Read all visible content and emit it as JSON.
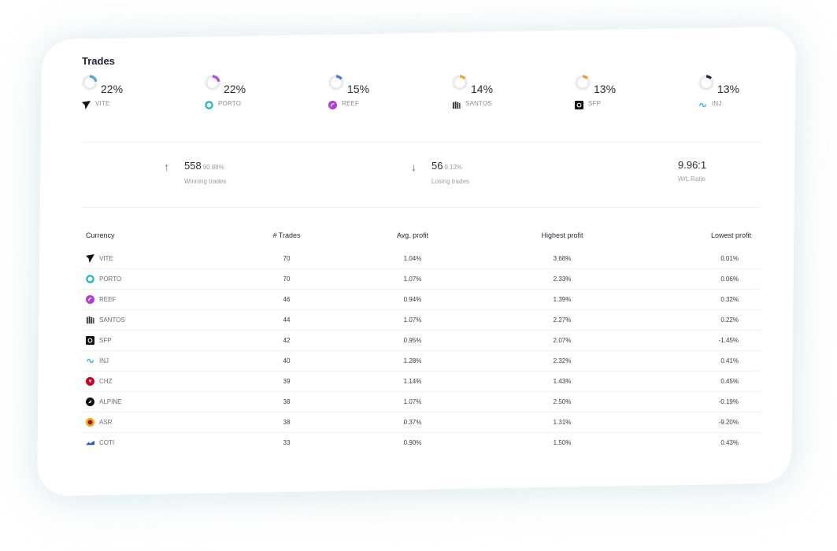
{
  "title": "Trades",
  "top_currencies": [
    {
      "pct": "22%",
      "name": "VITE",
      "value": 22,
      "icon": "vite-icon",
      "color": "#5aa8c8"
    },
    {
      "pct": "22%",
      "name": "PORTO",
      "value": 22,
      "icon": "porto-icon",
      "color": "#b44fd6"
    },
    {
      "pct": "15%",
      "name": "REEF",
      "value": 15,
      "icon": "reef-icon",
      "color": "#4a7bd4"
    },
    {
      "pct": "14%",
      "name": "SANTOS",
      "value": 14,
      "icon": "santos-icon",
      "color": "#f0a73a"
    },
    {
      "pct": "13%",
      "name": "SFP",
      "value": 13,
      "icon": "sfp-icon",
      "color": "#e8a033"
    },
    {
      "pct": "13%",
      "name": "INJ",
      "value": 13,
      "icon": "inj-icon",
      "color": "#2a2d52"
    }
  ],
  "stats": {
    "winning": {
      "count": "558",
      "pct": "90.88%",
      "label": "Winning trades"
    },
    "losing": {
      "count": "56",
      "pct": "9.12%",
      "label": "Losing trades"
    },
    "ratio": {
      "value": "9.96:1",
      "label": "W/L Ratio"
    }
  },
  "table": {
    "headers": [
      "Currency",
      "# Trades",
      "Avg. profit",
      "Highest profit",
      "Lowest profit"
    ],
    "rows": [
      {
        "currency": "VITE",
        "icon": "vite-icon",
        "trades": "70",
        "avg": "1.04%",
        "high": "3.68%",
        "low": "0.01%",
        "low_neg": false
      },
      {
        "currency": "PORTO",
        "icon": "porto-icon",
        "trades": "70",
        "avg": "1.07%",
        "high": "2.33%",
        "low": "0.06%",
        "low_neg": false
      },
      {
        "currency": "REEF",
        "icon": "reef-icon",
        "trades": "46",
        "avg": "0.94%",
        "high": "1.39%",
        "low": "0.32%",
        "low_neg": false
      },
      {
        "currency": "SANTOS",
        "icon": "santos-icon",
        "trades": "44",
        "avg": "1.07%",
        "high": "2.27%",
        "low": "0.22%",
        "low_neg": false
      },
      {
        "currency": "SFP",
        "icon": "sfp-icon",
        "trades": "42",
        "avg": "0.95%",
        "high": "2.07%",
        "low": "-1.45%",
        "low_neg": true
      },
      {
        "currency": "INJ",
        "icon": "inj-icon",
        "trades": "40",
        "avg": "1.28%",
        "high": "2.32%",
        "low": "0.41%",
        "low_neg": false
      },
      {
        "currency": "CHZ",
        "icon": "chz-icon",
        "trades": "39",
        "avg": "1.14%",
        "high": "1.43%",
        "low": "0.45%",
        "low_neg": false
      },
      {
        "currency": "ALPINE",
        "icon": "alpine-icon",
        "trades": "38",
        "avg": "1.07%",
        "high": "2.50%",
        "low": "-0.19%",
        "low_neg": true
      },
      {
        "currency": "ASR",
        "icon": "asr-icon",
        "trades": "38",
        "avg": "0.37%",
        "high": "1.31%",
        "low": "-9.20%",
        "low_neg": true
      },
      {
        "currency": "COTI",
        "icon": "coti-icon",
        "trades": "33",
        "avg": "0.90%",
        "high": "1.50%",
        "low": "0.43%",
        "low_neg": false
      }
    ]
  },
  "colors": {
    "positive": "#2fbf8a",
    "negative": "#ef5b5b",
    "donut_track": "#e9ebee"
  }
}
